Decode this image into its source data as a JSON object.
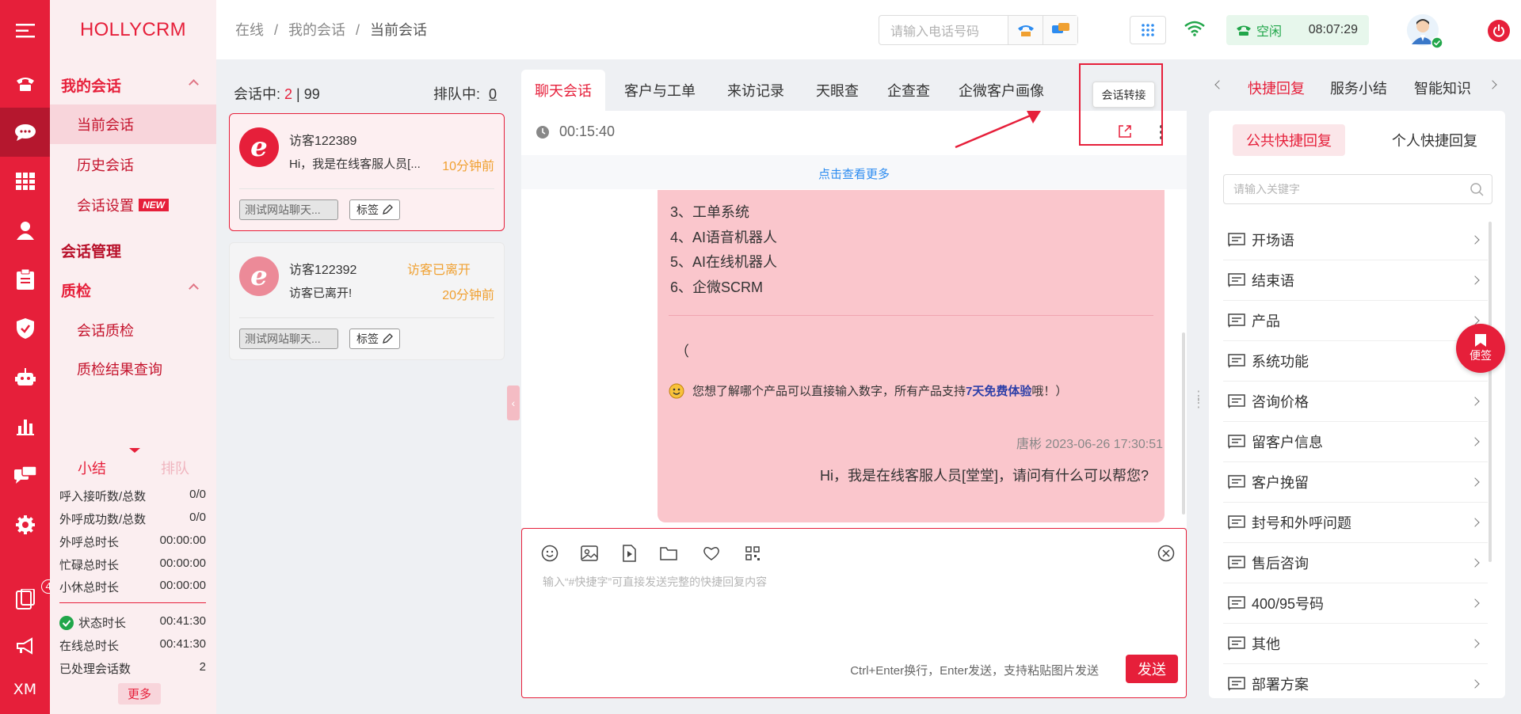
{
  "app": {
    "logo": "HOLLYCRM",
    "rail_bottom": "XM",
    "rail_badge": "42",
    "accent": "#e61f3a"
  },
  "nav": {
    "sections": [
      {
        "label": "我的会话",
        "items": [
          "当前会话",
          "历史会话",
          "会话设置"
        ]
      },
      {
        "label": "会话管理"
      },
      {
        "label": "质检",
        "items": [
          "会话质检",
          "质检结果查询"
        ]
      }
    ],
    "new_tag": "NEW",
    "summary_tabs": [
      "小结",
      "排队"
    ],
    "stats": [
      {
        "label": "呼入接听数/总数",
        "value": "0/0"
      },
      {
        "label": "外呼成功数/总数",
        "value": "0/0"
      },
      {
        "label": "外呼总时长",
        "value": "00:00:00"
      },
      {
        "label": "忙碌总时长",
        "value": "00:00:00"
      },
      {
        "label": "小休总时长",
        "value": "00:00:00"
      },
      {
        "label": "状态时长",
        "value": "00:41:30"
      },
      {
        "label": "在线总时长",
        "value": "00:41:30"
      },
      {
        "label": "已处理会话数",
        "value": "2"
      }
    ],
    "more": "更多"
  },
  "header": {
    "breadcrumb": [
      "在线",
      "我的会话",
      "当前会话"
    ],
    "phone_placeholder": "请输入电话号码",
    "status": "空闲",
    "time": "08:07:29"
  },
  "sessions": {
    "active_label": "会话中:",
    "active_count": "2",
    "active_max": "99",
    "queue_label": "排队中:",
    "queue_count": "0",
    "items": [
      {
        "name": "访客122389",
        "message": "Hi，我是在线客服人员[...",
        "time": "10分钟前",
        "tag": "测试网站聊天...",
        "label_btn": "标签"
      },
      {
        "name": "访客122392",
        "status": "访客已离开",
        "message": "访客已离开!",
        "time": "20分钟前",
        "tag": "测试网站聊天...",
        "label_btn": "标签"
      }
    ]
  },
  "chat": {
    "tabs": [
      "聊天会话",
      "客户与工单",
      "来访记录",
      "天眼查",
      "企查查",
      "企微客户画像"
    ],
    "timer": "00:15:40",
    "tooltip": "会话转接",
    "load_more": "点击查看更多",
    "bubble_lines": [
      "3、工单系统",
      "4、AI语音机器人",
      "5、AI在线机器人",
      "6、企微SCRM"
    ],
    "bubble_paren": "（",
    "bubble_note_pre": "您想了解哪个产品可以直接输入数字，所有产品支持",
    "bubble_note_bold": "7天免费体验",
    "bubble_note_post": "哦！）",
    "sender_meta": "唐彬 2023-06-26 17:30:51",
    "my_message": "Hi，我是在线客服人员[堂堂]，请问有什么可以帮您?",
    "input_placeholder": "输入“#快捷字”可直接发送完整的快捷回复内容",
    "send_hint": "Ctrl+Enter换行，Enter发送，支持粘贴图片发送",
    "send": "发送"
  },
  "right": {
    "tabs": [
      "快捷回复",
      "服务小结",
      "智能知识"
    ],
    "subtabs": [
      "公共快捷回复",
      "个人快捷回复"
    ],
    "search_placeholder": "请输入关键字",
    "items": [
      "开场语",
      "结束语",
      "产品",
      "系统功能",
      "咨询价格",
      "留客户信息",
      "客户挽留",
      "封号和外呼问题",
      "售后咨询",
      "400/95号码",
      "其他",
      "部署方案"
    ],
    "memo": "便签"
  }
}
